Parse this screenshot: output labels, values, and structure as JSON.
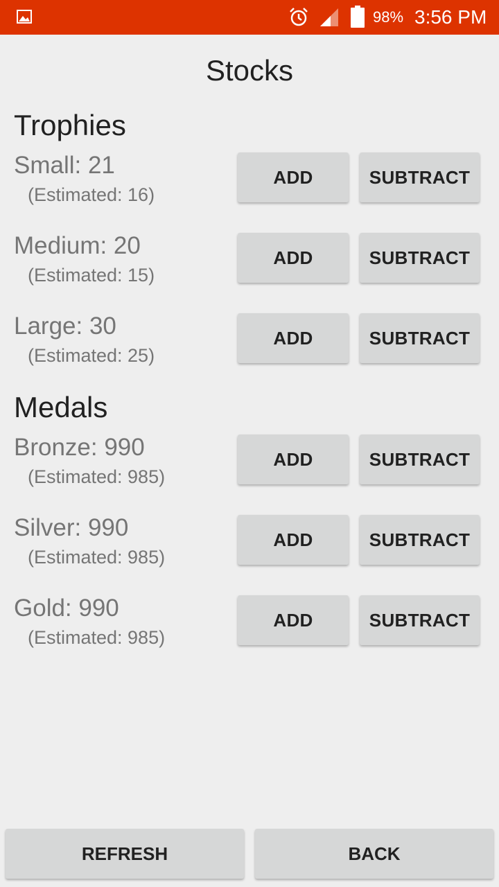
{
  "status_bar": {
    "battery_percent": "98%",
    "time": "3:56 PM",
    "icons": [
      "gallery-icon",
      "alarm-icon",
      "signal-icon",
      "battery-icon"
    ],
    "background_color": "#dd3300"
  },
  "title": "Stocks",
  "trophies": {
    "heading": "Trophies",
    "items": [
      {
        "label": "Small: 21",
        "estimate": "(Estimated: 16)"
      },
      {
        "label": "Medium: 20",
        "estimate": "(Estimated: 15)"
      },
      {
        "label": "Large: 30",
        "estimate": "(Estimated: 25)"
      }
    ]
  },
  "medals": {
    "heading": "Medals",
    "items": [
      {
        "label": "Bronze: 990",
        "estimate": "(Estimated: 985)"
      },
      {
        "label": "Silver: 990",
        "estimate": "(Estimated: 985)"
      },
      {
        "label": "Gold: 990",
        "estimate": "(Estimated: 985)"
      }
    ]
  },
  "buttons": {
    "add": "ADD",
    "subtract": "SUBTRACT",
    "refresh": "REFRESH",
    "back": "BACK"
  }
}
